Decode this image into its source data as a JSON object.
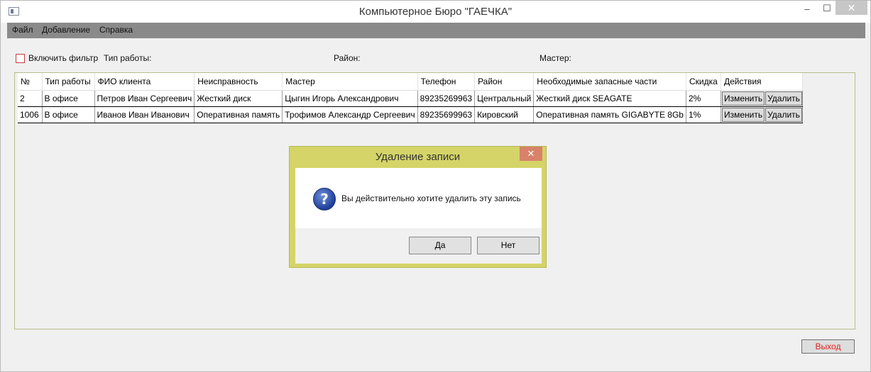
{
  "window": {
    "title": "Компьютерное Бюро \"ГАЕЧКА\"",
    "minimize_glyph": "‒",
    "maximize_glyph": "☐",
    "close_glyph": "✕"
  },
  "menu": [
    "Файл",
    "Добавление",
    "Справка"
  ],
  "filter": {
    "checkbox_label": "Включить фильтр",
    "work_type_label": "Тип работы:",
    "district_label": "Район:",
    "master_label": "Мастер:",
    "enabled": false
  },
  "grid": {
    "columns": [
      "№",
      "Тип работы",
      "ФИО клиента",
      "Неисправность",
      "Мастер",
      "Телефон",
      "Район",
      "Необходимые запасные части",
      "Скидка",
      "Действия"
    ],
    "rows": [
      {
        "id": "2",
        "work_type": "В офисе",
        "client": "Петров Иван Сергеевич",
        "fault": "Жесткий диск",
        "master": "Цыгин Игорь Александрович",
        "phone": "89235269963",
        "district": "Центральный",
        "parts": "Жесткий диск SEAGATE",
        "discount": "2%"
      },
      {
        "id": "1006",
        "work_type": "В офисе",
        "client": "Иванов Иван Иванович",
        "fault": "Оперативная память",
        "master": "Трофимов Александр Сергеевич",
        "phone": "89235699963",
        "district": "Кировский",
        "parts": "Оперативная память GIGABYTE 8Gb",
        "discount": "1%"
      }
    ],
    "edit_label": "Изменить",
    "delete_label": "Удалить"
  },
  "exit_label": "Выход",
  "dialog": {
    "title": "Удаление записи",
    "close_glyph": "✕",
    "icon_glyph": "?",
    "message": "Вы действительно хотите удалить эту запись",
    "yes_label": "Да",
    "no_label": "Нет"
  },
  "colors": {
    "dialog_frame": "#d4d468",
    "menubar": "#8a8a8a",
    "exit_text": "#e02020",
    "checkbox_border": "#c43d3d"
  }
}
